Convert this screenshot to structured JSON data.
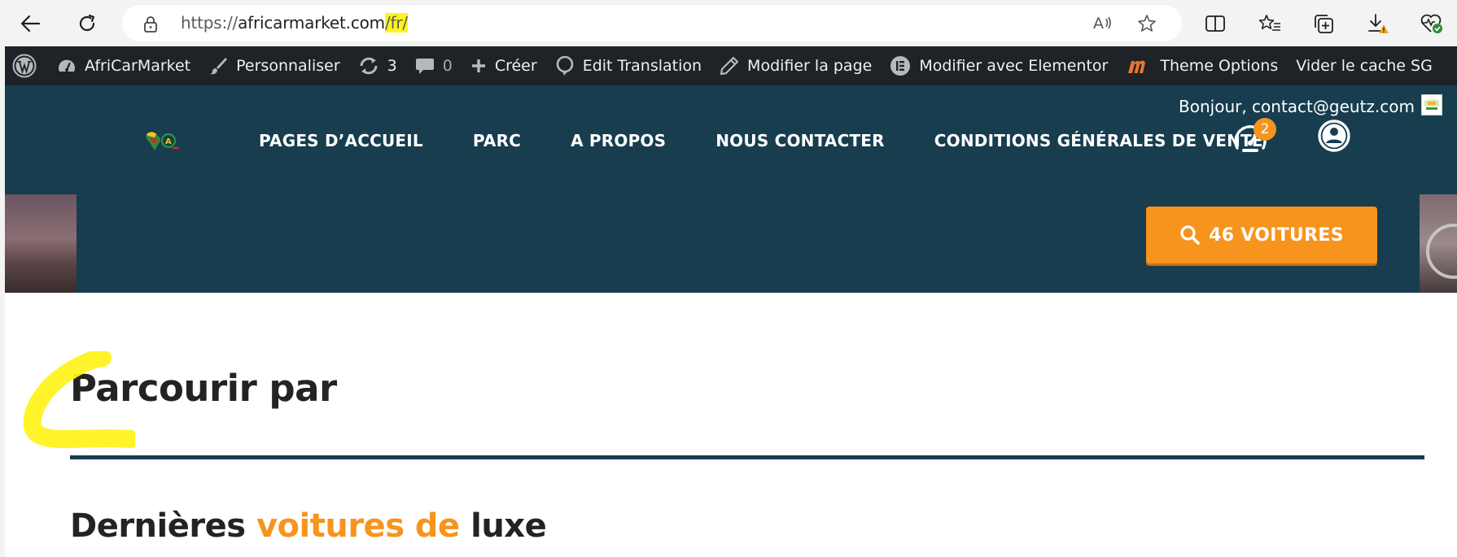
{
  "browser": {
    "url_prefix": "https://",
    "url_domain": "africarmarket.com",
    "url_highlight": "/fr/"
  },
  "adminbar": {
    "site_name": "AfriCarMarket",
    "customize": "Personnaliser",
    "updates_count": "3",
    "comments_count": "0",
    "create": "Créer",
    "edit_translation": "Edit Translation",
    "edit_page": "Modifier la page",
    "edit_elementor": "Modifier avec Elementor",
    "theme_options": "Theme Options",
    "clear_cache": "Vider le cache SG"
  },
  "header": {
    "greeting": "Bonjour, contact@geutz.com",
    "nav": [
      "PAGES D’ACCUEIL",
      "PARC",
      "A PROPOS",
      "NOUS CONTACTER",
      "CONDITIONS GÉNÉRALES DE VENTE"
    ],
    "compare_badge": "2",
    "cta_label": "46 VOITURES"
  },
  "content": {
    "browse_heading": "Parcourir par",
    "latest_heading_part1": "Dernières ",
    "latest_heading_accent": "voitures de",
    "latest_heading_part2": " luxe"
  },
  "colors": {
    "brand_dark": "#173d4f",
    "accent_orange": "#f7941d",
    "adminbar_bg": "#1d2327",
    "highlight_yellow": "#fff31e"
  },
  "icons": [
    "back-arrow-icon",
    "refresh-icon",
    "lock-icon",
    "read-aloud-icon",
    "star-icon",
    "split-screen-icon",
    "favorites-icon",
    "collections-icon",
    "download-icon",
    "health-icon",
    "wordpress-icon",
    "dashboard-icon",
    "brush-icon",
    "updates-icon",
    "comment-icon",
    "plus-icon",
    "translate-icon",
    "pencil-icon",
    "elementor-icon",
    "theme-options-icon",
    "speedometer-icon",
    "user-icon",
    "search-icon"
  ]
}
